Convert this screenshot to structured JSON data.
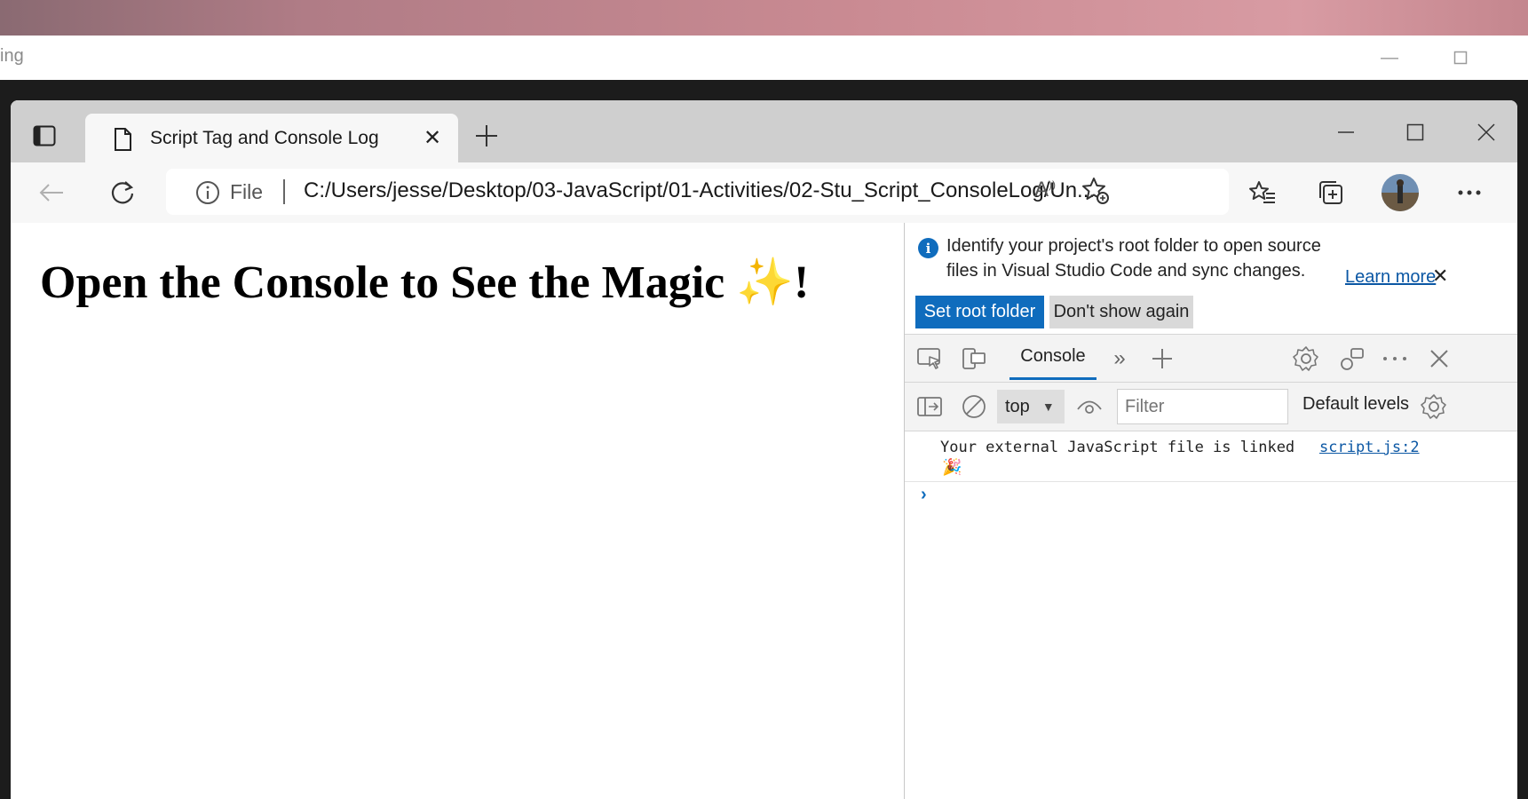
{
  "background_window": {
    "title_fragment": "ing"
  },
  "browser": {
    "tab": {
      "title": "Script Tag and Console Log"
    },
    "address_bar": {
      "scheme_label": "File",
      "url": "C:/Users/jesse/Desktop/03-JavaScript/01-Activities/02-Stu_Script_ConsoleLog/Un..."
    }
  },
  "page": {
    "heading": "Open the Console to See the Magic",
    "heading_emoji": "✨",
    "heading_end": "!"
  },
  "devtools": {
    "banner": {
      "message": "Identify your project's root folder to open source files in Visual Studio Code and sync changes.",
      "learn_more": "Learn more",
      "set_root_button": "Set root folder",
      "dont_show_button": "Don't show again"
    },
    "tabs": {
      "console_label": "Console"
    },
    "console_toolbar": {
      "context": "top",
      "filter_placeholder": "Filter",
      "levels_label": "Default levels"
    },
    "log": {
      "message": "Your external JavaScript file is linked",
      "emoji": "🎉",
      "source": "script.js:2"
    }
  },
  "colors": {
    "accent": "#0f6cbd",
    "tabstrip": "#cfcfcf",
    "toolbar": "#f7f7f7"
  }
}
